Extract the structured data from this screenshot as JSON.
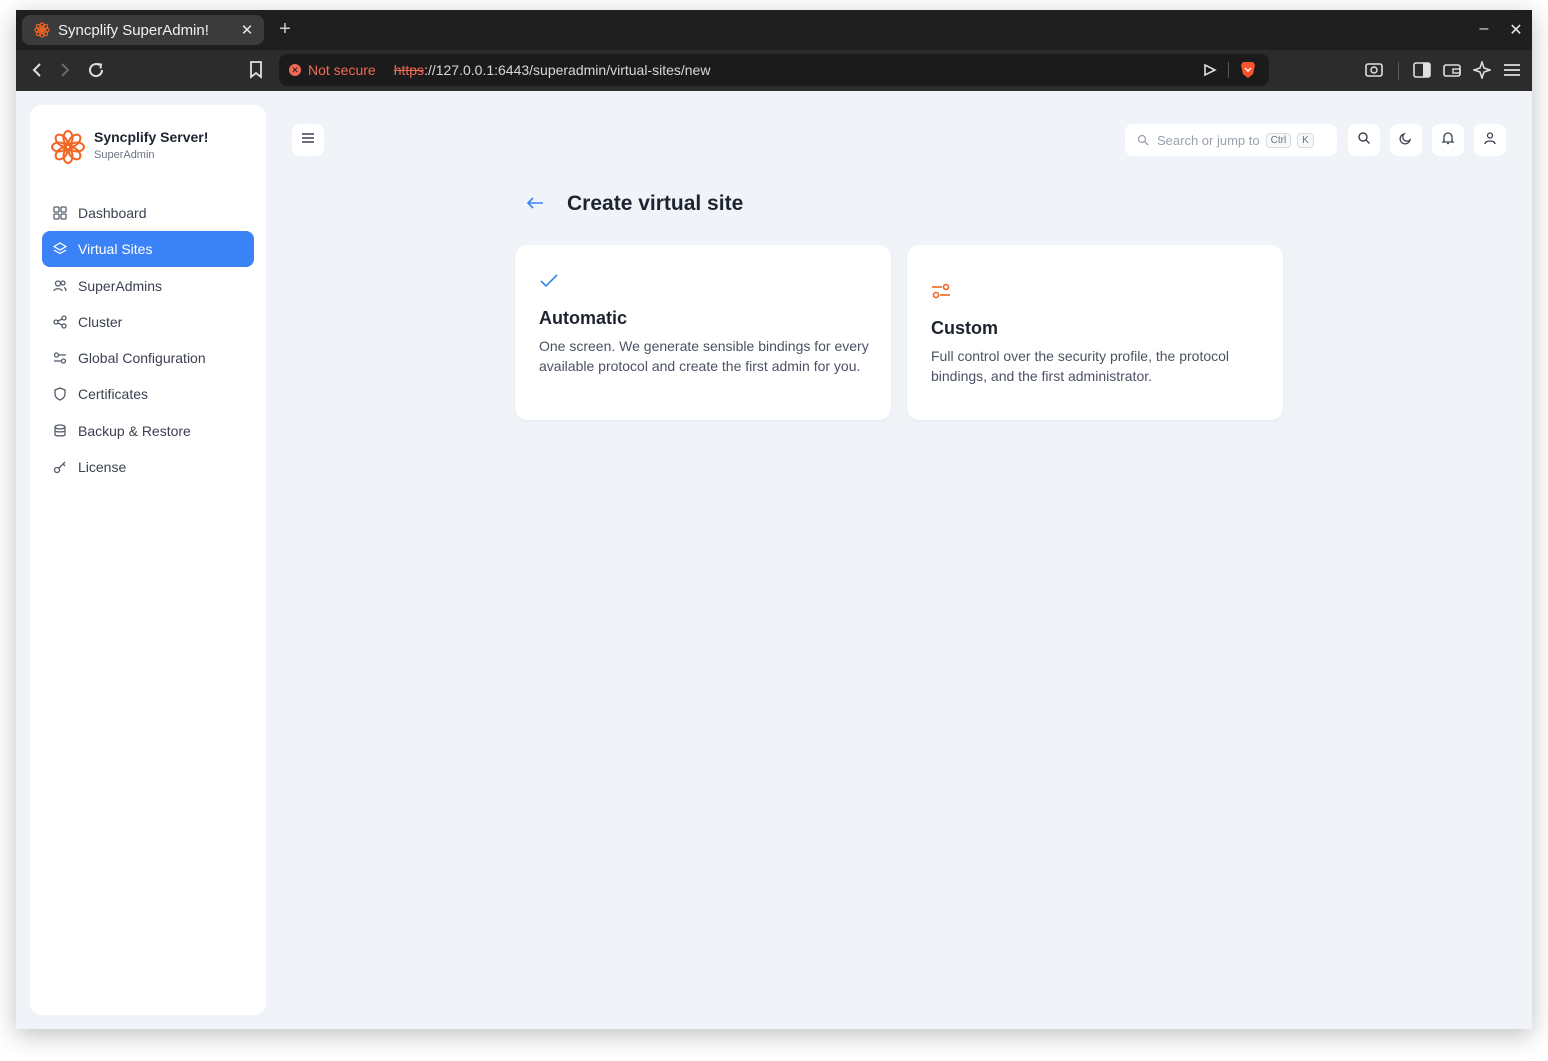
{
  "browser": {
    "tab_title": "Syncplify SuperAdmin!",
    "tab_close": "✕",
    "new_tab": "+",
    "minimize": "–",
    "close_window": "✕",
    "security_label": "Not secure",
    "url_scheme": "https",
    "url_rest": "://127.0.0.1:6443/superadmin/virtual-sites/new"
  },
  "sidebar": {
    "brand_name": "Syncplify Server!",
    "brand_role": "SuperAdmin",
    "items": [
      {
        "label": "Dashboard",
        "icon": "grid-icon",
        "active": false
      },
      {
        "label": "Virtual Sites",
        "icon": "layers-icon",
        "active": true
      },
      {
        "label": "SuperAdmins",
        "icon": "users-icon",
        "active": false
      },
      {
        "label": "Cluster",
        "icon": "share-icon",
        "active": false
      },
      {
        "label": "Global Configuration",
        "icon": "sliders-icon",
        "active": false
      },
      {
        "label": "Certificates",
        "icon": "shield-icon",
        "active": false
      },
      {
        "label": "Backup & Restore",
        "icon": "database-icon",
        "active": false
      },
      {
        "label": "License",
        "icon": "key-icon",
        "active": false
      }
    ]
  },
  "topbar": {
    "search_placeholder": "Search or jump to",
    "kbd_ctrl": "Ctrl",
    "kbd_k": "K"
  },
  "main": {
    "title": "Create virtual site",
    "cards": [
      {
        "title": "Automatic",
        "description": "One screen. We generate sensible bindings for every available protocol and create the first admin for you.",
        "icon": "check-icon"
      },
      {
        "title": "Custom",
        "description": "Full control over the security profile, the protocol bindings, and the first administrator.",
        "icon": "sliders-icon"
      }
    ]
  },
  "colors": {
    "accent": "#3b82f6",
    "brand_orange": "#f26522",
    "page_bg": "#f0f4f8"
  }
}
